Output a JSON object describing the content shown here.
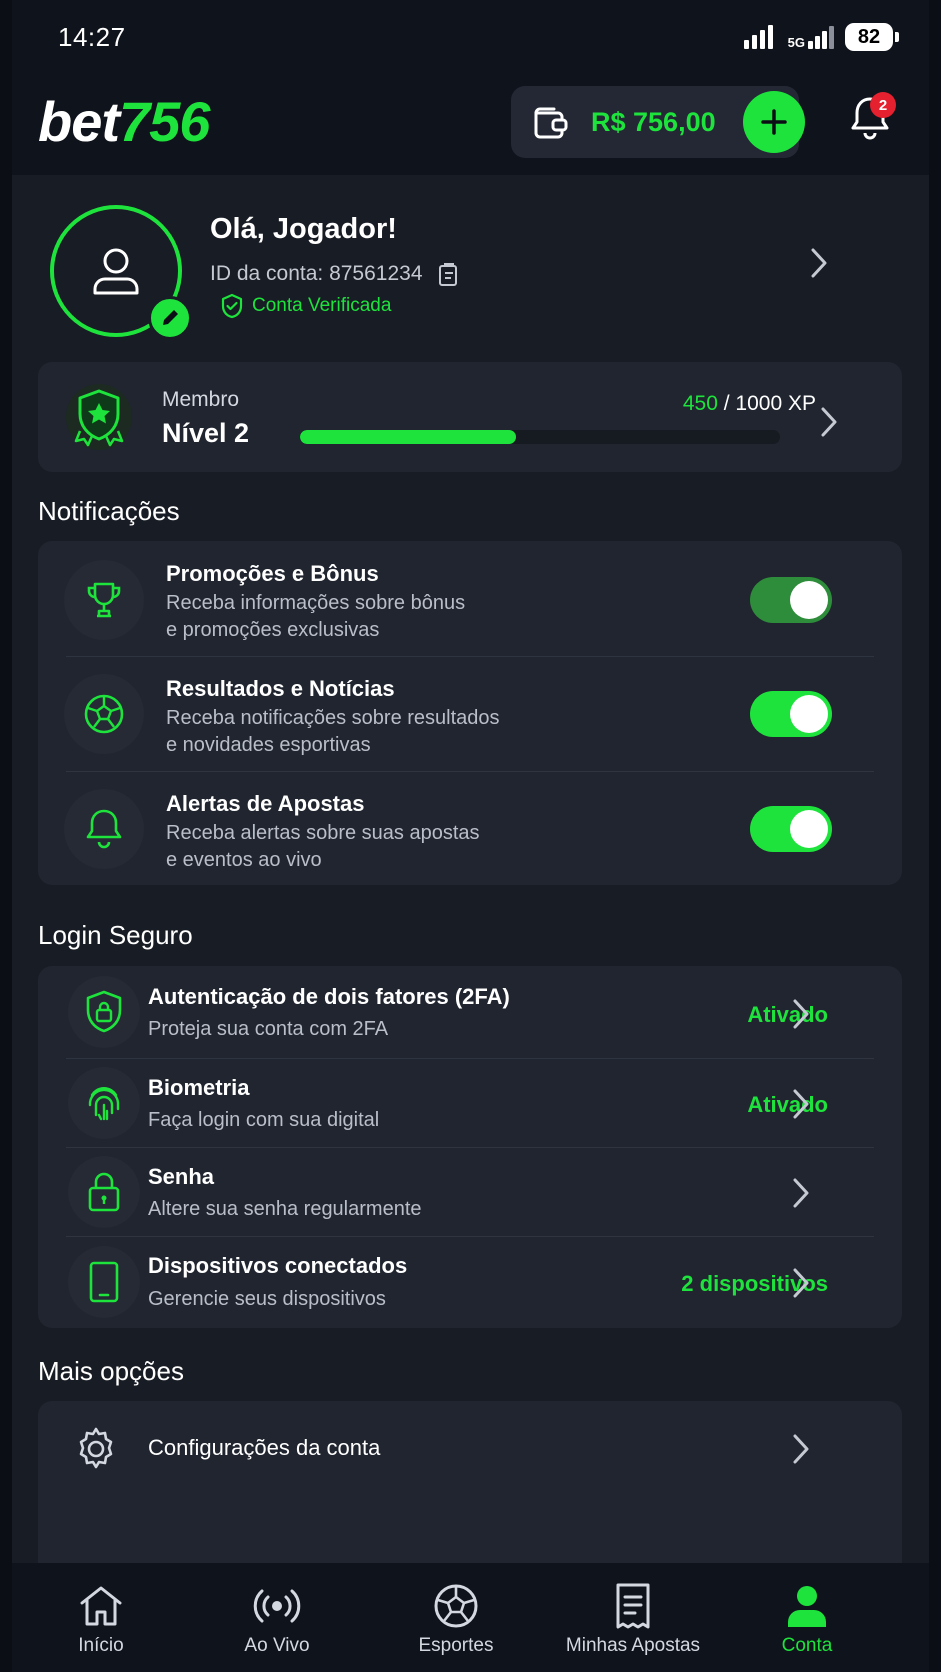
{
  "status_bar": {
    "time": "14:27",
    "network": "5G",
    "battery": "82"
  },
  "header": {
    "logo_white": "bet",
    "logo_green": "756",
    "balance": "R$ 756,00",
    "notification_count": "2"
  },
  "profile": {
    "greeting": "Olá, Jogador!",
    "account_id": "ID da conta: 87561234",
    "verified": "Conta Verificada"
  },
  "level": {
    "label": "Membro",
    "value": "Nível 2",
    "xp_current": "450",
    "xp_total": " / 1000 XP",
    "xp_progress_fraction": 0.45
  },
  "notifications": {
    "title": "Notificações",
    "items": [
      {
        "icon": "trophy-icon",
        "title": "Promoções e Bônus",
        "desc1": "Receba informações sobre bônus",
        "desc2": "e promoções exclusivas",
        "enabled": true
      },
      {
        "icon": "soccer-ball-icon",
        "title": "Resultados e Notícias",
        "desc1": "Receba notificações sobre resultados",
        "desc2": "e novidades esportivas",
        "enabled": true
      },
      {
        "icon": "bell-icon",
        "title": "Alertas de Apostas",
        "desc1": "Receba alertas sobre suas apostas",
        "desc2": "e eventos ao vivo",
        "enabled": true
      }
    ]
  },
  "security": {
    "title": "Login Seguro",
    "items": [
      {
        "icon": "shield-lock-icon",
        "title": "Autenticação de dois fatores (2FA)",
        "desc": "Proteja sua conta com 2FA",
        "status": "Ativado"
      },
      {
        "icon": "fingerprint-icon",
        "title": "Biometria",
        "desc": "Faça login com sua digital",
        "status": "Ativado"
      },
      {
        "icon": "lock-icon",
        "title": "Senha",
        "desc": "Altere sua senha regularmente",
        "status": ""
      },
      {
        "icon": "tablet-icon",
        "title": "Dispositivos conectados",
        "desc": "Gerencie seus dispositivos",
        "status": "2 dispositivos"
      }
    ]
  },
  "more": {
    "title": "Mais opções",
    "items": [
      {
        "icon": "gear-icon",
        "title": "Configurações da conta"
      }
    ]
  },
  "bottom_nav": {
    "items": [
      {
        "icon": "home-icon",
        "label": "Início"
      },
      {
        "icon": "live-icon",
        "label": "Ao Vivo"
      },
      {
        "icon": "soccer-ball-icon",
        "label": "Esportes"
      },
      {
        "icon": "receipt-icon",
        "label": "Minhas Apostas"
      },
      {
        "icon": "user-icon",
        "label": "Conta"
      }
    ],
    "active": "Conta"
  },
  "colors": {
    "accent": "#1ee33c",
    "background": "#181c24",
    "card": "#20252f",
    "header": "#0f131b",
    "badge": "#e5202f"
  }
}
